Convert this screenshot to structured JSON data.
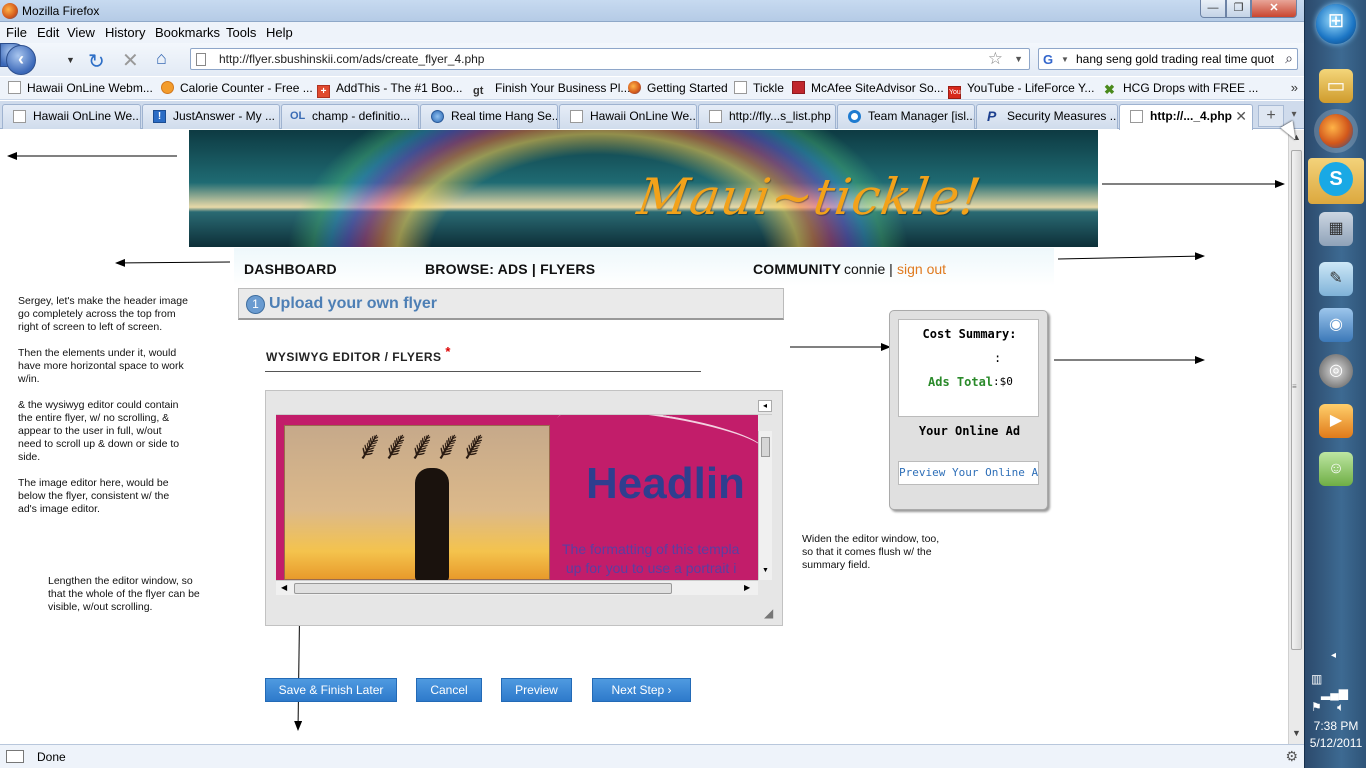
{
  "window": {
    "title": "Mozilla Firefox",
    "controls": {
      "minimize": "—",
      "maximize": "❐",
      "close": "✕"
    }
  },
  "menubar": {
    "items": [
      "File",
      "Edit",
      "View",
      "History",
      "Bookmarks",
      "Tools",
      "Help"
    ]
  },
  "navbar": {
    "url": "http://flyer.sbushinskii.com/ads/create_flyer_4.php",
    "search_text": "hang seng gold trading real time quot"
  },
  "bookmarks": {
    "items": [
      {
        "label": "Hawaii OnLine Webm...",
        "icon": "page-icon"
      },
      {
        "label": "Calorie Counter - Free ...",
        "icon": "calorie-icon"
      },
      {
        "label": "AddThis - The #1 Boo...",
        "icon": "addthis-icon"
      },
      {
        "label": "Finish Your Business Pl...",
        "icon": "gt-icon"
      },
      {
        "label": "Getting Started",
        "icon": "firefox-icon"
      },
      {
        "label": "Tickle",
        "icon": "page-icon"
      },
      {
        "label": "McAfee SiteAdvisor So...",
        "icon": "mcafee-shield-icon"
      },
      {
        "label": "YouTube - LifeForce Y...",
        "icon": "youtube-icon"
      },
      {
        "label": "HCG Drops with FREE ...",
        "icon": "hcg-icon"
      }
    ],
    "more": "»"
  },
  "tabs": [
    {
      "label": "Hawaii OnLine We...",
      "icon": "page-icon"
    },
    {
      "label": "JustAnswer - My ...",
      "icon": "justanswer-icon"
    },
    {
      "label": "champ - definitio...",
      "icon": "oneLook-icon"
    },
    {
      "label": "Real time Hang Se...",
      "icon": "globe-icon"
    },
    {
      "label": "Hawaii OnLine We...",
      "icon": "page-icon"
    },
    {
      "label": "http://fly...s_list.php",
      "icon": "page-icon"
    },
    {
      "label": "Team Manager [isl...",
      "icon": "team-icon"
    },
    {
      "label": "Security Measures ...",
      "icon": "paypal-icon"
    },
    {
      "label": "http://..._4.php",
      "icon": "page-icon",
      "active": true
    }
  ],
  "page": {
    "banner_logo": "Maui~tickle!",
    "nav": {
      "dashboard": "DASHBOARD",
      "browse": "BROWSE: ADS | FLYERS",
      "community": "COMMUNITY",
      "user": "connie  |",
      "signout": "sign out"
    },
    "upload_header": {
      "number": "1",
      "title": "Upload your own flyer"
    },
    "editor": {
      "label": "WYSIWYG EDITOR / FLYERS",
      "required_mark": "*",
      "flyer_headline": "Headlin",
      "flyer_body": "The formatting of this templa\n up for you to use a portrait i"
    },
    "buttons": {
      "save": "Save & Finish Later",
      "cancel": "Cancel",
      "preview": "Preview",
      "next": "Next Step  ›"
    },
    "cost_summary": {
      "title": "Cost Summary:",
      "colon": ":",
      "total_label": "Ads Total",
      "total_value": ":$0",
      "online_ad_title": "Your Online Ad",
      "preview_online": "Preview Your Online Ad"
    },
    "notes": {
      "note1": "Sergey, let's make the header image\ngo completely across the top from\nright of screen to left of screen.\n\nThen the elements under it, would\nhave more horizontal space to work\nw/in.\n\n& the wysiwyg editor could contain\nthe entire flyer, w/ no scrolling, &\nappear to the user in full, w/out\nneed to scroll up & down or side to\nside.\n\nThe image editor here, would be\nbelow the flyer, consistent w/ the\nad's image editor.",
      "note2": "Lengthen the editor window, so\nthat the whole of the flyer can be\nvisible, w/out scrolling.",
      "note3": "Widen the editor window, too,\nso that it comes flush w/ the\nsummary field."
    }
  },
  "status": {
    "text": "Done"
  },
  "taskbar": {
    "time": "7:38 PM",
    "date": "5/12/2011"
  }
}
